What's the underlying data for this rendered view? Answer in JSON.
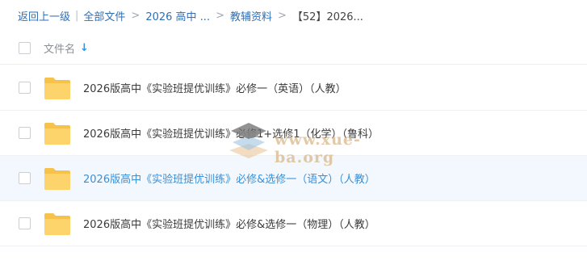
{
  "breadcrumb": {
    "back": "返回上一级",
    "all_files": "全部文件",
    "level1": "2026 高中 ...",
    "level2": "教辅资料",
    "current": "【52】2026..."
  },
  "header": {
    "column_name": "文件名",
    "sort_icon": "arrow-down-icon"
  },
  "files": [
    {
      "name": "2026版高中《实验班提优训练》必修一（英语）（人教）",
      "icon": "folder-icon"
    },
    {
      "name": "2026版高中《实验班提优训练》必修1+选修1（化学）（鲁科）",
      "icon": "folder-icon"
    },
    {
      "name": "2026版高中《实验班提优训练》必修&选修一（语文）（人教）",
      "icon": "folder-icon",
      "hovered": true
    },
    {
      "name": "2026版高中《实验班提优训练》必修&选修一（物理）（人教）",
      "icon": "folder-icon"
    }
  ],
  "watermark": {
    "text": "www.xue-ba.org"
  },
  "colors": {
    "link": "#2f6fb6",
    "hover_text": "#3b8fd6",
    "hover_bg": "#f2f8fe",
    "folder": "#fcd46b"
  }
}
